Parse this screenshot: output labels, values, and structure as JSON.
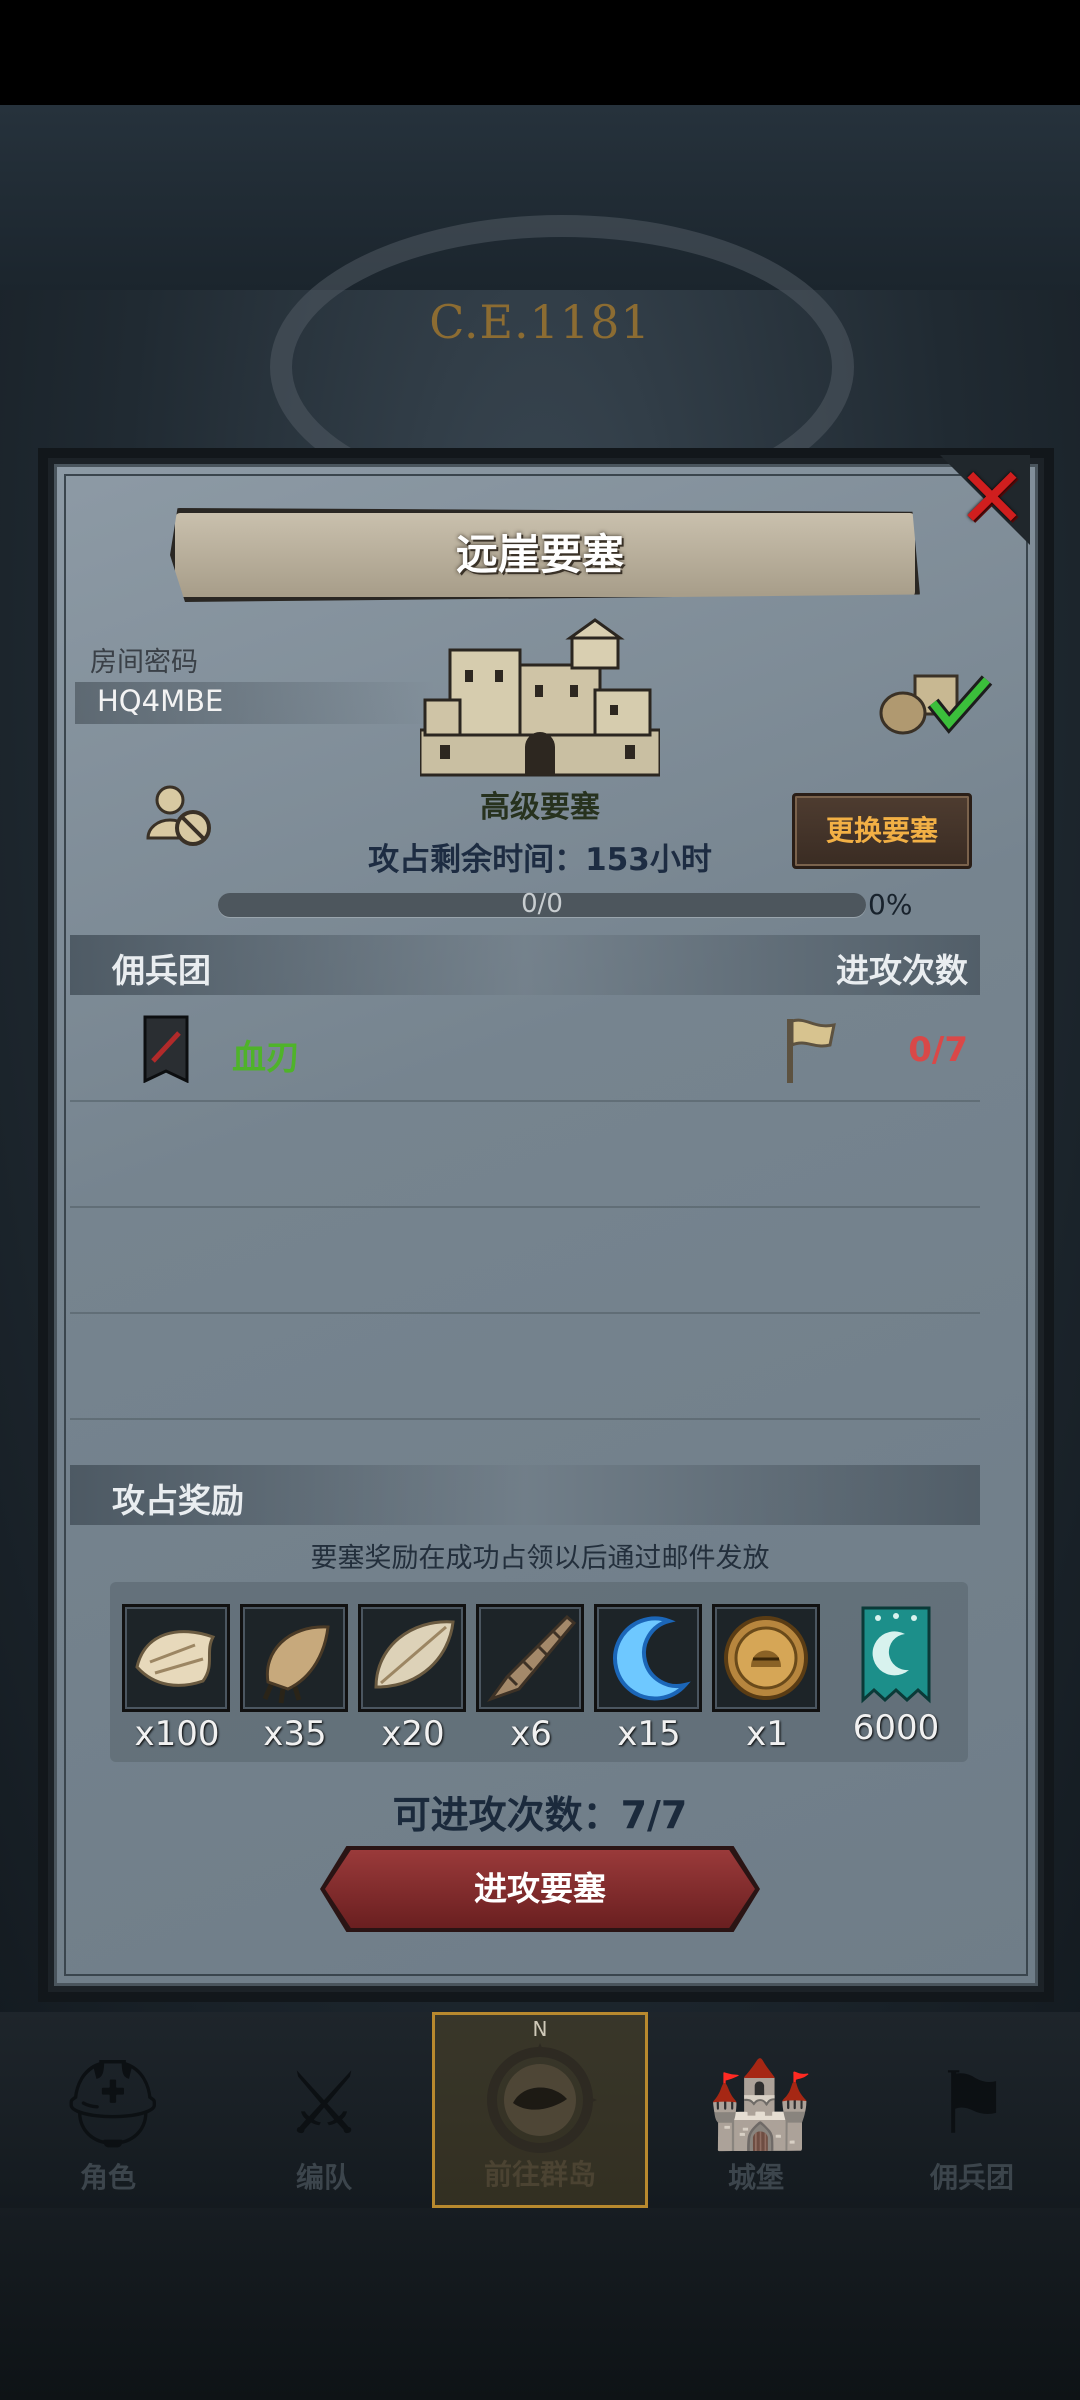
{
  "background": {
    "era": "C.E.1181"
  },
  "dialog": {
    "title": "远崖要塞",
    "room_label": "房间密码",
    "room_code": "HQ4MBE",
    "fortress_type": "高级要塞",
    "change_button": "更换要塞",
    "remaining_time": "攻占剩余时间：153小时",
    "progress": {
      "text": "0/0",
      "percent_label": "0%",
      "fraction": 0
    },
    "mercenary_header": "佣兵团",
    "attack_count_header": "进攻次数",
    "mercenaries": [
      {
        "name": "血刃",
        "attacks": "0/7"
      }
    ],
    "reward_header": "攻占奖励",
    "reward_note": "要塞奖励在成功占领以后通过邮件发放",
    "rewards": [
      {
        "icon": "fur-icon",
        "qty": "x100"
      },
      {
        "icon": "claw-icon",
        "qty": "x35"
      },
      {
        "icon": "feather-fur-icon",
        "qty": "x20"
      },
      {
        "icon": "horn-icon",
        "qty": "x6"
      },
      {
        "icon": "crescent-blade-icon",
        "qty": "x15"
      },
      {
        "icon": "knight-coin-icon",
        "qty": "x1"
      },
      {
        "icon": "guild-banner-icon",
        "qty": "6000"
      }
    ],
    "attacks_left": "可进攻次数：7/7",
    "attack_button": "进攻要塞"
  },
  "nav": {
    "items": [
      {
        "label": "角色",
        "icon": "knight-helmet-icon"
      },
      {
        "label": "编队",
        "icon": "formation-icon"
      },
      {
        "label": "前往群岛",
        "icon": "compass-map-icon"
      },
      {
        "label": "城堡",
        "icon": "castle-icon"
      },
      {
        "label": "佣兵团",
        "icon": "mercenary-flag-icon"
      }
    ],
    "compass_letter": "N"
  },
  "colors": {
    "merc_name": "#4fb32a",
    "attack_count": "#d94848",
    "change_button_text": "#f2b045",
    "close": "#d01e1e"
  }
}
